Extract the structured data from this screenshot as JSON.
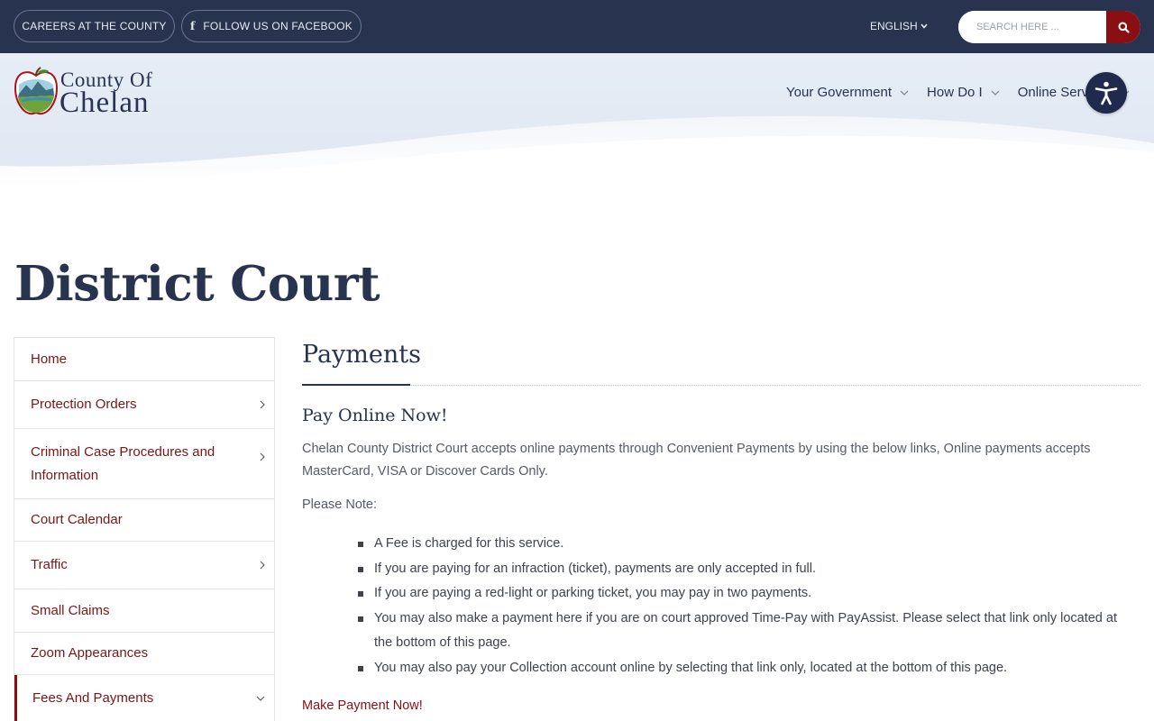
{
  "topbar": {
    "careers_label": "CAREERS AT THE COUNTY",
    "facebook_label": "FOLLOW US ON FACEBOOK",
    "facebook_icon": "facebook-icon",
    "language_label": "ENGLISH",
    "search_placeholder": "SEARCH HERE ...",
    "search_icon": "search-icon",
    "bar_color": "#283350",
    "accent_color": "#8a0f12"
  },
  "header": {
    "logo_line1": "County Of",
    "logo_line2": "Chelan",
    "nav": [
      {
        "label": "Your Government"
      },
      {
        "label": "How Do I"
      },
      {
        "label": "Online Services"
      }
    ],
    "accessibility_icon": "accessibility-icon"
  },
  "page": {
    "title": "District Court"
  },
  "sidebar": {
    "items": [
      {
        "label": "Home",
        "has_children": false
      },
      {
        "label": "Protection Orders",
        "has_children": true
      },
      {
        "label": "Criminal Case Procedures and Information",
        "has_children": true
      },
      {
        "label": "Court Calendar",
        "has_children": false
      },
      {
        "label": "Traffic",
        "has_children": true
      },
      {
        "label": "Small Claims",
        "has_children": false
      },
      {
        "label": "Zoom Appearances",
        "has_children": false
      },
      {
        "label": "Fees And Payments",
        "has_children": true,
        "active": true,
        "expanded": true
      }
    ]
  },
  "main": {
    "heading": "Payments",
    "subheading": "Pay Online Now!",
    "lead": "Chelan County District Court accepts online payments through Convenient Payments by using the below links, Online payments accepts MasterCard, VISA or Discover Cards Only.",
    "note_label": "Please Note:",
    "bullets": [
      "A Fee is charged for this service.",
      "If you are paying for an infraction (ticket), payments are only accepted in full.",
      "If you are paying a red-light or parking ticket, you may pay in two payments.",
      "You may also make a payment here if you are on court approved Time-Pay with PayAssist. Please select that link only located at the bottom of this page.",
      "You may also pay your Collection account online by selecting that link only, located at the bottom of this page."
    ],
    "pay_link": "Make Payment Now!"
  }
}
